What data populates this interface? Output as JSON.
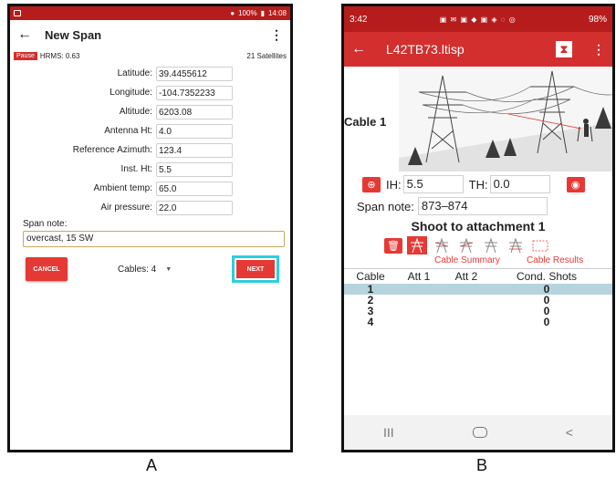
{
  "phone_a": {
    "status_bar": {
      "battery": "100%",
      "time": "14:08"
    },
    "app_bar": {
      "back": "←",
      "title": "New Span",
      "menu": "⋮"
    },
    "info_bar": {
      "pause": "Pause",
      "hrms": "HRMS: 0.63",
      "satellites": "21 Satellites"
    },
    "fields": [
      {
        "label": "Latitude:",
        "value": "39.4455612"
      },
      {
        "label": "Longitude:",
        "value": "-104.7352233"
      },
      {
        "label": "Altitude:",
        "value": "6203.08"
      },
      {
        "label": "Antenna Ht:",
        "value": "4.0"
      },
      {
        "label": "Reference Azimuth:",
        "value": "123.4"
      },
      {
        "label": "Inst. Ht:",
        "value": "5.5"
      },
      {
        "label": "Ambient temp:",
        "value": "65.0"
      },
      {
        "label": "Air pressure:",
        "value": "22.0"
      }
    ],
    "span_note_label": "Span note:",
    "span_note_value": "overcast, 15 SW",
    "cancel_label": "CANCEL",
    "cables_label": "Cables: 4",
    "next_label": "NEXT",
    "accent_highlight": "#29d0e0"
  },
  "phone_b": {
    "status_bar": {
      "time": "3:42",
      "battery": "98%"
    },
    "app_bar": {
      "back": "←",
      "title": "L42TB73.ltisp",
      "menu": "⋮"
    },
    "cable_label": "Cable 1",
    "ih_label": "IH:",
    "ih_value": "5.5",
    "th_label": "TH:",
    "th_value": "0.0",
    "span_note_label": "Span note:",
    "span_note_value": "873–874",
    "shoot_title": "Shoot to attachment 1",
    "tabs": {
      "summary": "Cable Summary",
      "results": "Cable Results"
    },
    "table": {
      "headers": [
        "Cable",
        "Att 1",
        "Att 2",
        "Cond. Shots"
      ],
      "rows": [
        [
          "1",
          "",
          "",
          "0"
        ],
        [
          "2",
          "",
          "",
          "0"
        ],
        [
          "3",
          "",
          "",
          "0"
        ],
        [
          "4",
          "",
          "",
          "0"
        ]
      ]
    },
    "nav": {
      "recents": "III",
      "back": "<"
    },
    "brand_red": "#d32f2f",
    "row_highlight": "#b6d4de"
  },
  "captions": {
    "a": "A",
    "b": "B"
  }
}
